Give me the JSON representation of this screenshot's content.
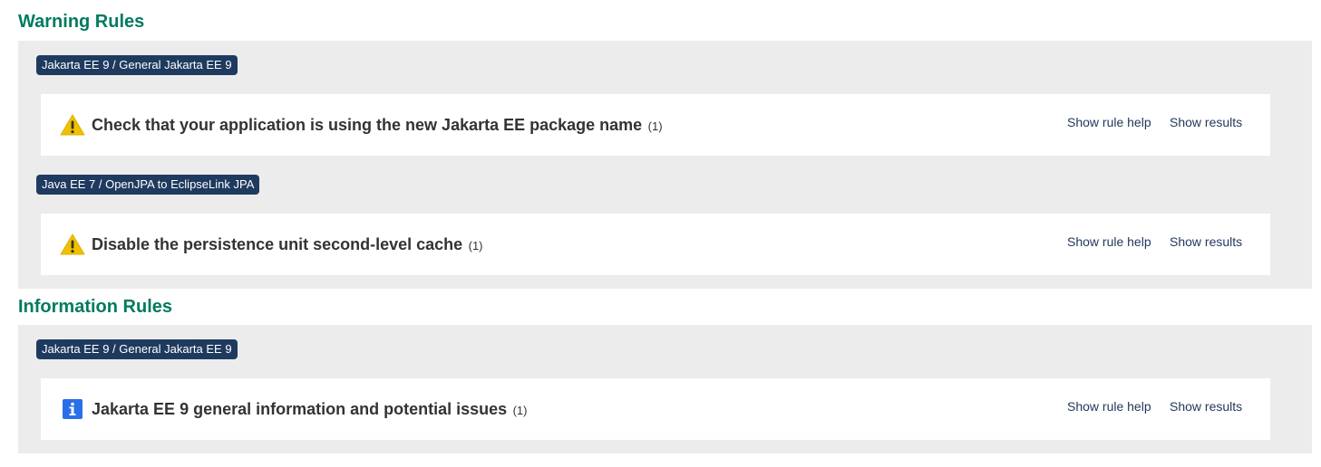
{
  "sections": {
    "warning": {
      "title": "Warning Rules",
      "groups": [
        {
          "badge": "Jakarta EE 9 / General Jakarta EE 9",
          "rule": {
            "icon": "warning-icon",
            "name": "Check that your application is using the new Jakarta EE package name",
            "count": "(1)",
            "help_label": "Show rule help",
            "results_label": "Show results"
          }
        },
        {
          "badge": "Java EE 7 / OpenJPA to EclipseLink JPA",
          "rule": {
            "icon": "warning-icon",
            "name": "Disable the persistence unit second-level cache",
            "count": "(1)",
            "help_label": "Show rule help",
            "results_label": "Show results"
          }
        }
      ]
    },
    "information": {
      "title": "Information Rules",
      "groups": [
        {
          "badge": "Jakarta EE 9 / General Jakarta EE 9",
          "rule": {
            "icon": "info-icon",
            "name": "Jakarta EE 9 general information and potential issues",
            "count": "(1)",
            "help_label": "Show rule help",
            "results_label": "Show results"
          }
        }
      ]
    }
  },
  "colors": {
    "section_title": "#007b5f",
    "badge_bg": "#1f3a5f",
    "group_bg": "#ececec",
    "warning_icon": "#f0c000",
    "info_icon": "#2b6fe8",
    "link": "#22395c"
  }
}
